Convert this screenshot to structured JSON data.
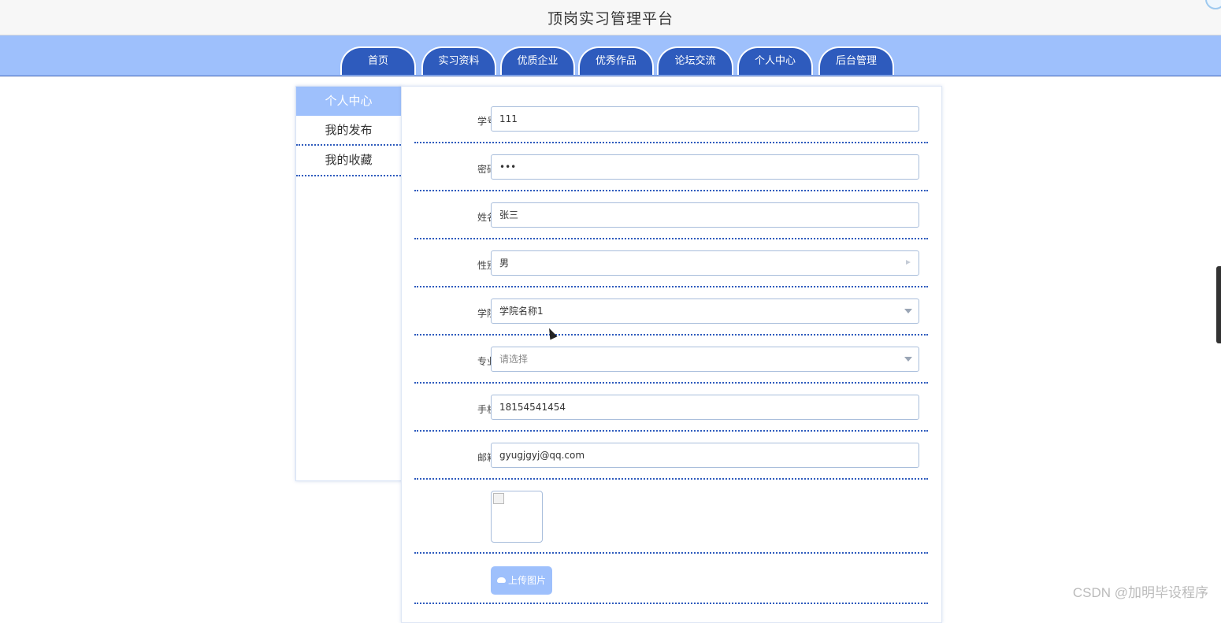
{
  "site": {
    "title": "顶岗实习管理平台"
  },
  "nav": {
    "tabs": [
      "首页",
      "实习资料",
      "优质企业",
      "优秀作品",
      "论坛交流",
      "个人中心",
      "后台管理"
    ]
  },
  "sidebar": {
    "header": "个人中心",
    "items": [
      "我的发布",
      "我的收藏"
    ]
  },
  "form": {
    "student_id": {
      "label": "学号",
      "value": "111"
    },
    "password": {
      "label": "密码",
      "value": "•••"
    },
    "name": {
      "label": "姓名",
      "value": "张三"
    },
    "gender": {
      "label": "性别",
      "value": "男"
    },
    "college": {
      "label": "学院",
      "value": "学院名称1"
    },
    "major": {
      "label": "专业",
      "placeholder": "请选择"
    },
    "phone": {
      "label": "手机",
      "value": "18154541454"
    },
    "email": {
      "label": "邮箱",
      "value": "gyugjgyj@qq.com"
    },
    "upload_label": "上传图片"
  },
  "watermark": "CSDN @加明毕设程序"
}
